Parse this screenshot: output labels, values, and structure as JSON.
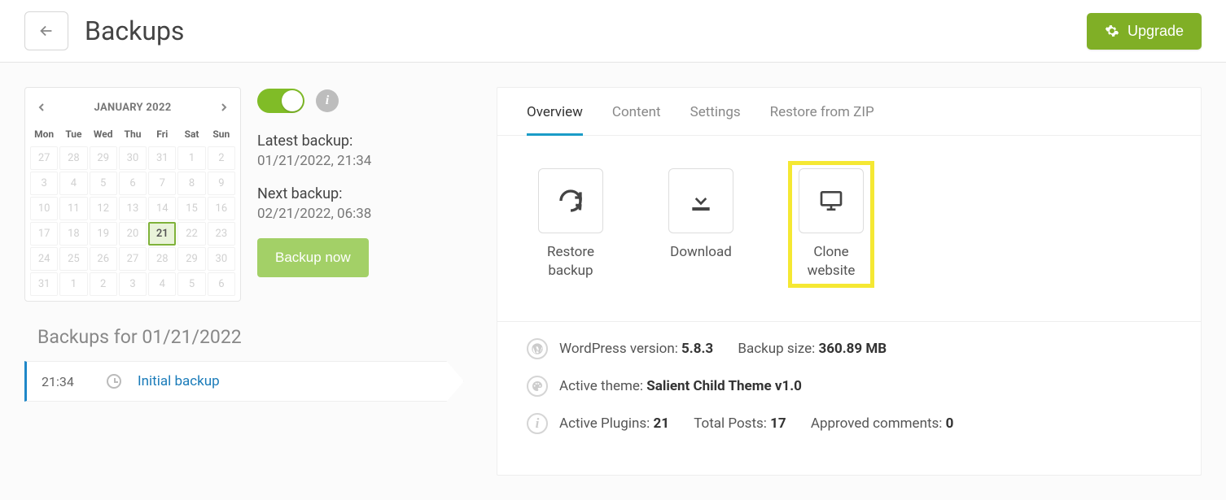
{
  "header": {
    "title": "Backups",
    "upgrade_label": "Upgrade"
  },
  "calendar": {
    "month_label": "JANUARY 2022",
    "day_heads": [
      "Mon",
      "Tue",
      "Wed",
      "Thu",
      "Fri",
      "Sat",
      "Sun"
    ],
    "cells": [
      "27",
      "28",
      "29",
      "30",
      "31",
      "1",
      "2",
      "3",
      "4",
      "5",
      "6",
      "7",
      "8",
      "9",
      "10",
      "11",
      "12",
      "13",
      "14",
      "15",
      "16",
      "17",
      "18",
      "19",
      "20",
      "21",
      "22",
      "23",
      "24",
      "25",
      "26",
      "27",
      "28",
      "29",
      "30",
      "31",
      "1",
      "2",
      "3",
      "4",
      "5",
      "6"
    ],
    "selected_index": 25
  },
  "backup_info": {
    "latest_label": "Latest backup:",
    "latest_value": "01/21/2022, 21:34",
    "next_label": "Next backup:",
    "next_value": "02/21/2022, 06:38",
    "backup_now_label": "Backup now"
  },
  "backups_list": {
    "heading": "Backups for 01/21/2022",
    "items": [
      {
        "time": "21:34",
        "name": "Initial backup"
      }
    ]
  },
  "tabs": [
    "Overview",
    "Content",
    "Settings",
    "Restore from ZIP"
  ],
  "active_tab_index": 0,
  "actions": {
    "restore": "Restore backup",
    "download": "Download",
    "clone": "Clone website"
  },
  "details": {
    "wp_version_label": "WordPress version: ",
    "wp_version_value": "5.8.3",
    "backup_size_label": "Backup size: ",
    "backup_size_value": "360.89 MB",
    "theme_label": "Active theme: ",
    "theme_value": "Salient Child Theme v1.0",
    "plugins_label": "Active Plugins: ",
    "plugins_value": "21",
    "posts_label": "Total Posts: ",
    "posts_value": "17",
    "comments_label": "Approved comments: ",
    "comments_value": "0"
  }
}
